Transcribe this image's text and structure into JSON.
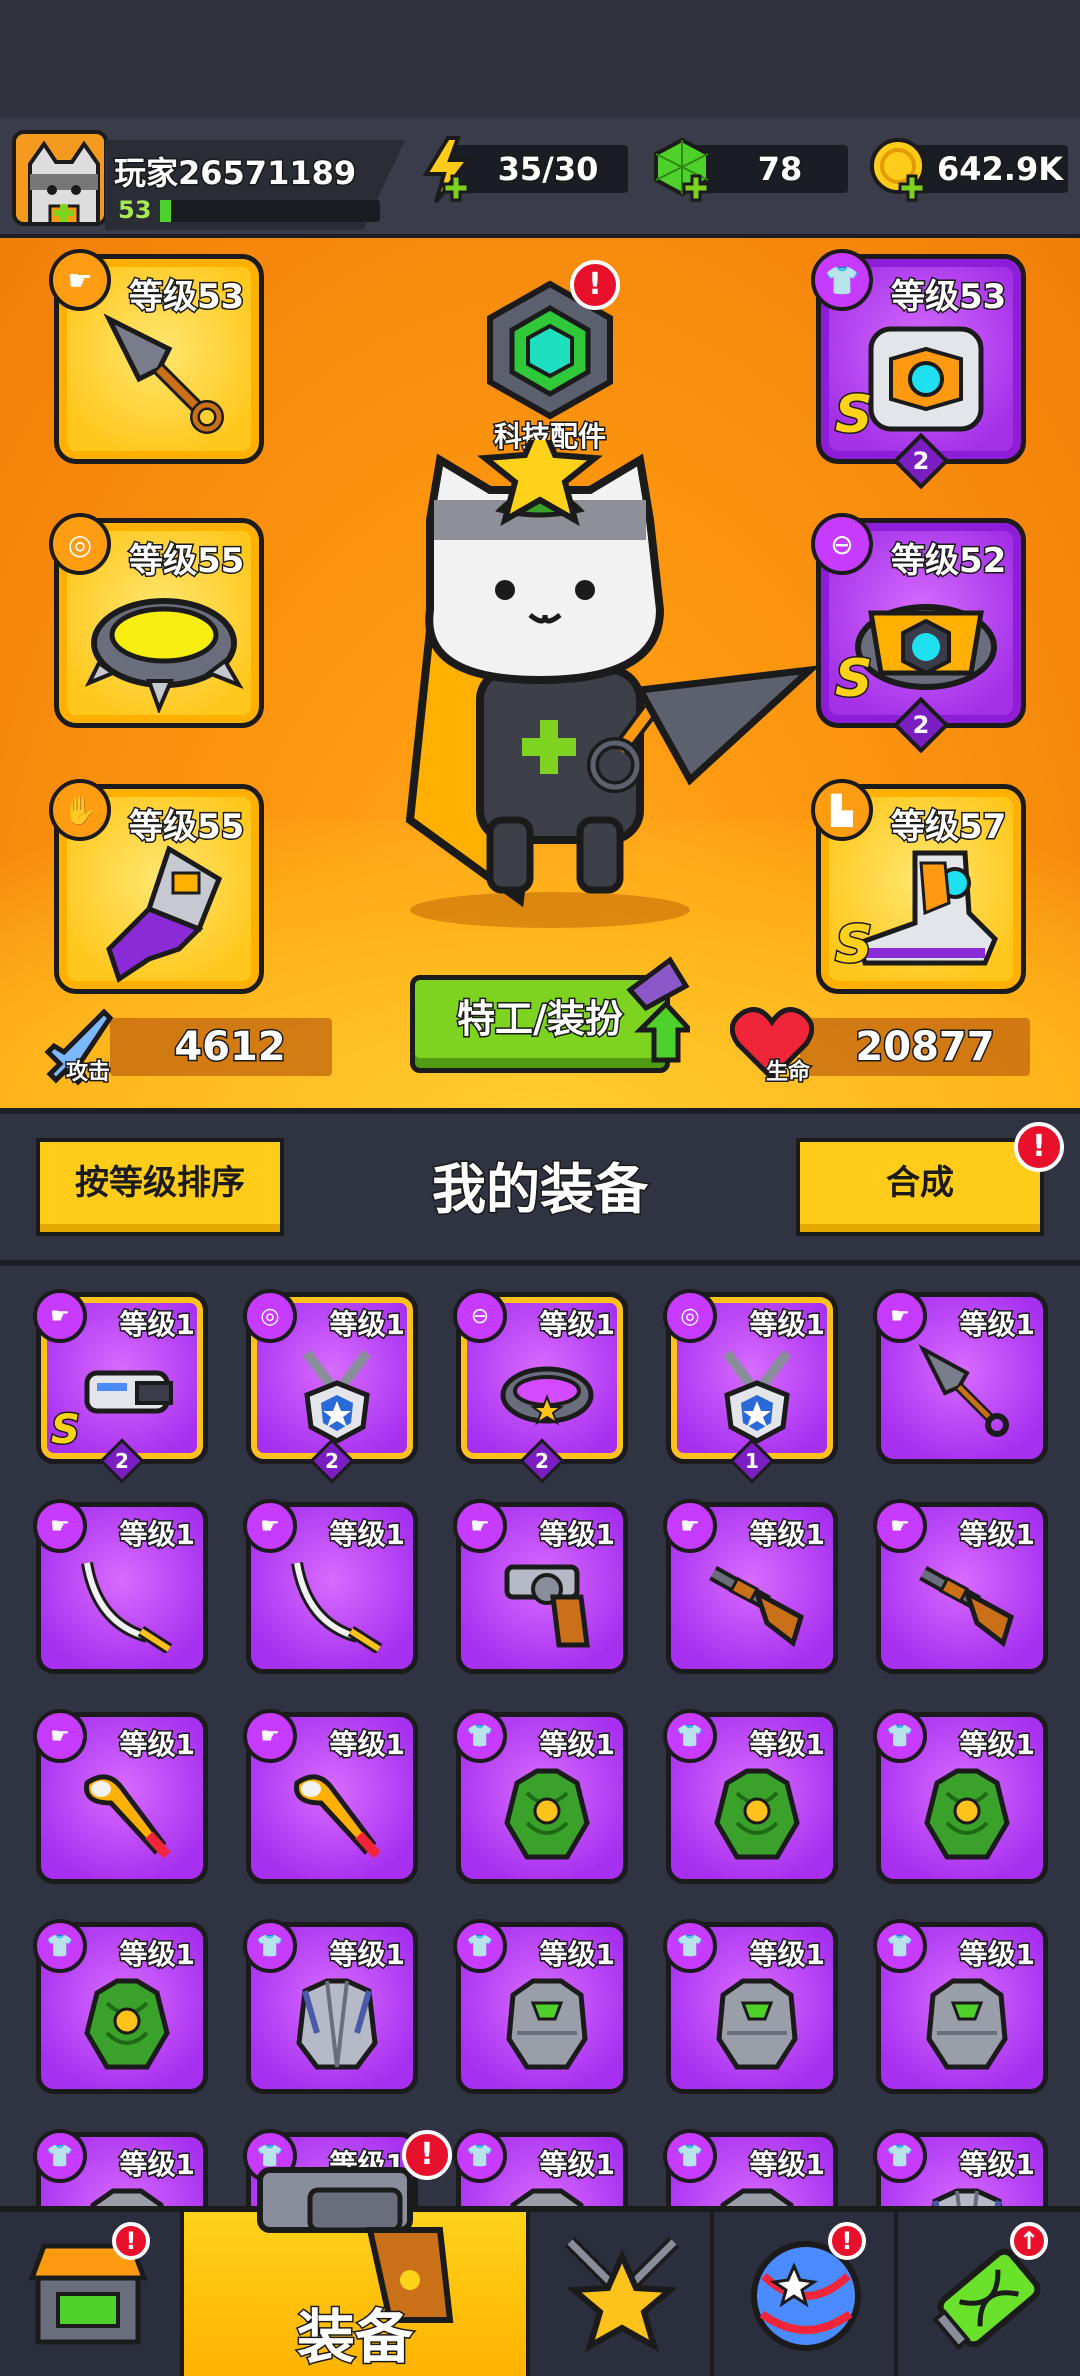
{
  "player": {
    "name": "玩家26571189",
    "level": "53",
    "xp_progress": 0.05
  },
  "resources": {
    "energy": "35/30",
    "gems": "78",
    "gold": "642.9K"
  },
  "hero": {
    "tech_label": "科技配件",
    "slots_left": [
      {
        "label": "等级53",
        "icon": "weapon-icon"
      },
      {
        "label": "等级55",
        "icon": "necklace-icon"
      },
      {
        "label": "等级55",
        "icon": "glove-icon"
      }
    ],
    "slots_right": [
      {
        "label": "等级53",
        "icon": "armor-icon",
        "grade": "S",
        "rank": "2"
      },
      {
        "label": "等级52",
        "icon": "belt-icon",
        "grade": "S",
        "rank": "2"
      },
      {
        "label": "等级57",
        "icon": "boot-icon",
        "grade": "S"
      }
    ],
    "attack_label": "攻击",
    "attack_value": "4612",
    "hp_label": "生命",
    "hp_value": "20877",
    "agent_button": "特工/装扮"
  },
  "equipment": {
    "sort_button": "按等级排序",
    "title": "我的装备",
    "merge_button": "合成",
    "items": [
      {
        "label": "等级1",
        "icon": "weapon-icon",
        "art": "laser-gun",
        "grade": "S",
        "rank": "2",
        "rare": true
      },
      {
        "label": "等级1",
        "icon": "necklace-icon",
        "art": "badge-necklace",
        "rank": "2",
        "rare": true
      },
      {
        "label": "等级1",
        "icon": "belt-icon",
        "art": "star-belt",
        "rank": "2",
        "rare": true
      },
      {
        "label": "等级1",
        "icon": "necklace-icon",
        "art": "badge-necklace",
        "rank": "1",
        "rare": true
      },
      {
        "label": "等级1",
        "icon": "weapon-icon",
        "art": "kunai"
      },
      {
        "label": "等级1",
        "icon": "weapon-icon",
        "art": "katana"
      },
      {
        "label": "等级1",
        "icon": "weapon-icon",
        "art": "katana"
      },
      {
        "label": "等级1",
        "icon": "weapon-icon",
        "art": "revolver"
      },
      {
        "label": "等级1",
        "icon": "weapon-icon",
        "art": "shotgun"
      },
      {
        "label": "等级1",
        "icon": "weapon-icon",
        "art": "shotgun"
      },
      {
        "label": "等级1",
        "icon": "weapon-icon",
        "art": "bat"
      },
      {
        "label": "等级1",
        "icon": "weapon-icon",
        "art": "bat"
      },
      {
        "label": "等级1",
        "icon": "armor-icon",
        "art": "leaf-armor"
      },
      {
        "label": "等级1",
        "icon": "armor-icon",
        "art": "leaf-armor"
      },
      {
        "label": "等级1",
        "icon": "armor-icon",
        "art": "leaf-armor"
      },
      {
        "label": "等级1",
        "icon": "armor-icon",
        "art": "leaf-armor"
      },
      {
        "label": "等级1",
        "icon": "armor-icon",
        "art": "steel-armor"
      },
      {
        "label": "等级1",
        "icon": "armor-icon",
        "art": "stone-armor"
      },
      {
        "label": "等级1",
        "icon": "armor-icon",
        "art": "stone-armor"
      },
      {
        "label": "等级1",
        "icon": "armor-icon",
        "art": "stone-armor"
      },
      {
        "label": "等级1",
        "icon": "armor-icon",
        "art": "stone-armor"
      },
      {
        "label": "等级1",
        "icon": "armor-icon",
        "art": "stone-armor"
      },
      {
        "label": "等级1",
        "icon": "armor-icon",
        "art": "stone-armor"
      },
      {
        "label": "等级1",
        "icon": "armor-icon",
        "art": "stone-armor"
      },
      {
        "label": "等级1",
        "icon": "armor-icon",
        "art": "steel-armor"
      }
    ]
  },
  "nav": {
    "tabs": [
      {
        "name": "shop-tab",
        "icon": "shop-icon",
        "alert": true
      },
      {
        "name": "equipment-tab",
        "icon": "revolver-icon",
        "label": "装备",
        "active": true,
        "alert": true
      },
      {
        "name": "battle-tab",
        "icon": "star-swords-icon"
      },
      {
        "name": "world-tab",
        "icon": "globe-icon",
        "alert": true
      },
      {
        "name": "lab-tab",
        "icon": "dna-battery-icon",
        "upgrade": true
      }
    ]
  },
  "colors": {
    "hero_bg": "#ff9a10",
    "slot_gold": "#ffc71c",
    "slot_purple": "#a431e8",
    "button_yellow": "#ffcc1a",
    "button_green": "#7ed321",
    "alert_red": "#e8102a"
  }
}
